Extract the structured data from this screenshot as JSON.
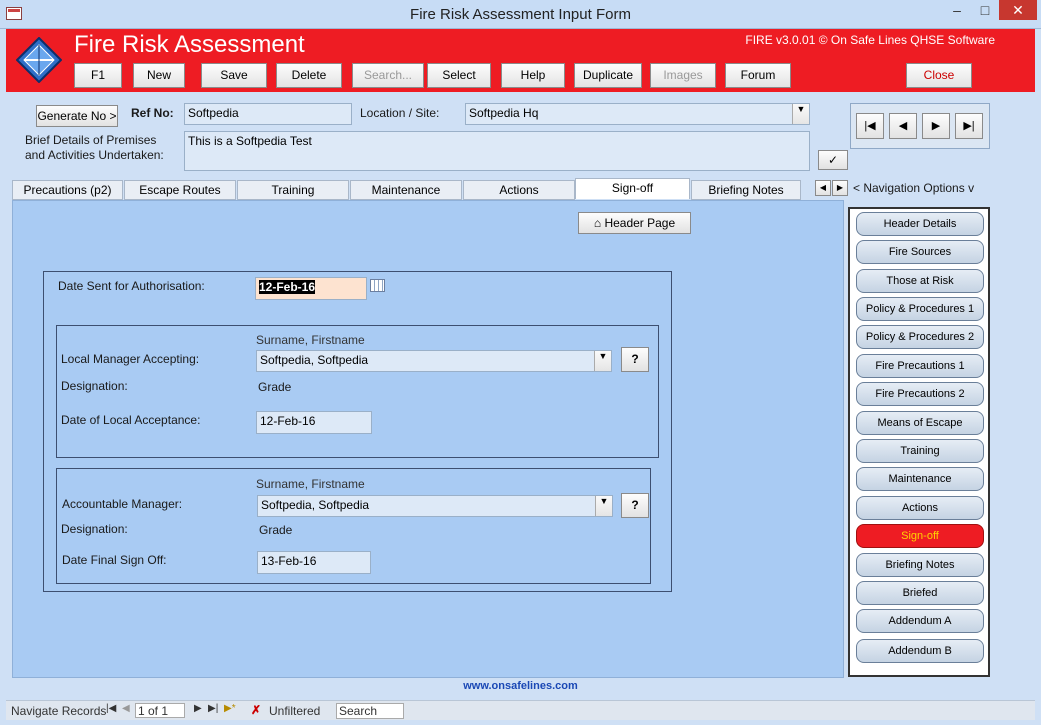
{
  "window": {
    "title": "Fire Risk Assessment Input Form",
    "minimize_icon": "minimize-icon",
    "maximize_icon": "maximize-icon",
    "close_icon": "close-icon"
  },
  "header": {
    "app_name": "Fire Risk Assessment",
    "version": "FIRE v3.0.01 © On Safe Lines QHSE Software",
    "brand_color": "#ee1c23",
    "buttons": [
      "F1",
      "New",
      "Save",
      "Delete",
      "Search...",
      "Select",
      "Help",
      "Duplicate",
      "Images",
      "Forum"
    ],
    "close_label": "Close"
  },
  "form": {
    "generate_label": "Generate No >",
    "ref_label": "Ref No:",
    "ref_value": "Softpedia",
    "location_label": "Location / Site:",
    "location_value": "Softpedia Hq",
    "brief_label_1": "Brief Details of Premises",
    "brief_label_2": "and Activities Undertaken:",
    "brief_value": "This is a Softpedia Test"
  },
  "tabs": [
    "Precautions (p2)",
    "Escape Routes",
    "Training",
    "Maintenance",
    "Actions",
    "Sign-off",
    "Briefing Notes"
  ],
  "active_tab": "Sign-off",
  "nav_options_label": "< Navigation Options v",
  "signoff": {
    "header_page_label": "Header Page",
    "date_sent_label": "Date Sent for Authorisation:",
    "date_sent_value": "12-Feb-16",
    "surname_hint": "Surname, Firstname",
    "local_manager_label": "Local Manager Accepting:",
    "local_manager_value": "Softpedia, Softpedia",
    "designation_label": "Designation:",
    "designation_value": "Grade",
    "local_date_label": "Date of Local Acceptance:",
    "local_date_value": "12-Feb-16",
    "accountable_label": "Accountable Manager:",
    "accountable_value": "Softpedia, Softpedia",
    "final_date_label": "Date Final Sign Off:",
    "final_date_value": "13-Feb-16",
    "help_label": "?"
  },
  "nav_buttons": [
    "Header Details",
    "Fire Sources",
    "Those at Risk",
    "Policy & Procedures 1",
    "Policy & Procedures 2",
    "Fire Precautions 1",
    "Fire Precautions 2",
    "Means of Escape",
    "Training",
    "Maintenance",
    "Actions",
    "Sign-off",
    "Briefing Notes",
    "Briefed",
    "Addendum A",
    "Addendum B"
  ],
  "active_nav": "Sign-off",
  "footer_link": "www.onsafelines.com",
  "status": {
    "navigate_label": "Navigate Records",
    "record_value": "1 of 1",
    "filter_label": "Unfiltered",
    "search_placeholder": "Search"
  }
}
